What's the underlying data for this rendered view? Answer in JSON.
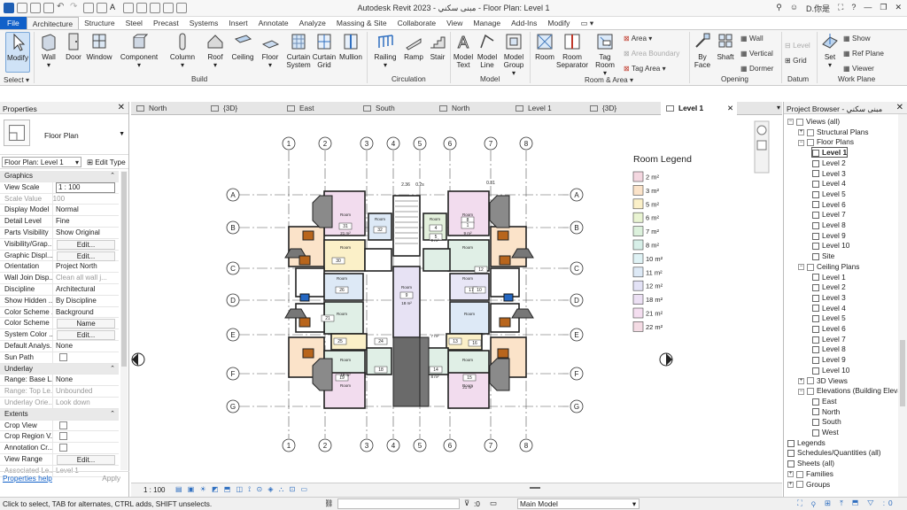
{
  "titlebar": {
    "title": "Autodesk Revit 2023 - مبنى سكني - Floor Plan: Level 1",
    "user": "D.你是"
  },
  "ribbon_tabs": [
    "File",
    "Architecture",
    "Structure",
    "Steel",
    "Precast",
    "Systems",
    "Insert",
    "Annotate",
    "Analyze",
    "Massing & Site",
    "Collaborate",
    "View",
    "Manage",
    "Add-Ins",
    "Modify"
  ],
  "ribbon": {
    "modify": "Modify",
    "wall": "Wall",
    "door": "Door",
    "window": "Window",
    "component": "Component",
    "column": "Column",
    "roof": "Roof",
    "ceiling": "Ceiling",
    "floor": "Floor",
    "curtain_system": "Curtain System",
    "curtain_grid": "Curtain Grid",
    "mullion": "Mullion",
    "railing": "Railing",
    "ramp": "Ramp",
    "stair": "Stair",
    "model_text": "Model Text",
    "model_line": "Model Line",
    "model_group": "Model Group",
    "room": "Room",
    "room_separator": "Room Separator",
    "tag_room": "Tag Room",
    "area": "Area",
    "area_boundary": "Area Boundary",
    "tag_area": "Tag Area",
    "by_face": "By Face",
    "shaft": "Shaft",
    "wall_op": "Wall",
    "vertical": "Vertical",
    "dormer": "Dormer",
    "level": "Level",
    "grid": "Grid",
    "set": "Set",
    "show": "Show",
    "ref_plane": "Ref Plane",
    "viewer": "Viewer",
    "groups": [
      "Select",
      "Build",
      "Circulation",
      "Model",
      "Room & Area",
      "Opening",
      "Datum",
      "Work Plane"
    ]
  },
  "properties": {
    "title": "Properties",
    "type_name": "Floor Plan",
    "filter": "Floor Plan: Level 1",
    "edit_type": "Edit Type",
    "rows": [
      {
        "k": "Graphics",
        "sec": true
      },
      {
        "k": "View Scale",
        "v": "1 : 100",
        "inp": true
      },
      {
        "k": "Scale Value",
        "p2": "1:",
        "v": "100",
        "dim": true
      },
      {
        "k": "Display Model",
        "v": "Normal"
      },
      {
        "k": "Detail Level",
        "v": "Fine"
      },
      {
        "k": "Parts Visibility",
        "v": "Show Original"
      },
      {
        "k": "Visibility/Grap...",
        "v": "Edit...",
        "btn": true
      },
      {
        "k": "Graphic Displ...",
        "v": "Edit...",
        "btn": true
      },
      {
        "k": "Orientation",
        "v": "Project North"
      },
      {
        "k": "Wall Join Disp...",
        "v": "Clean all wall j...",
        "dim2": true
      },
      {
        "k": "Discipline",
        "v": "Architectural"
      },
      {
        "k": "Show Hidden ...",
        "v": "By Discipline"
      },
      {
        "k": "Color Scheme ...",
        "v": "Background"
      },
      {
        "k": "Color Scheme",
        "v": "Name",
        "btn": true
      },
      {
        "k": "System Color ...",
        "v": "Edit...",
        "btn": true
      },
      {
        "k": "Default Analys...",
        "v": "None"
      },
      {
        "k": "Sun Path",
        "chk": true
      },
      {
        "k": "Underlay",
        "sec": true
      },
      {
        "k": "Range: Base L...",
        "v": "None"
      },
      {
        "k": "Range: Top Le...",
        "v": "Unbounded",
        "dim": true
      },
      {
        "k": "Underlay Orie...",
        "v": "Look down",
        "dim": true
      },
      {
        "k": "Extents",
        "sec": true
      },
      {
        "k": "Crop View",
        "chk": true
      },
      {
        "k": "Crop Region V...",
        "chk": true
      },
      {
        "k": "Annotation Cr...",
        "chk": true
      },
      {
        "k": "View Range",
        "v": "Edit...",
        "btn": true
      },
      {
        "k": "Associated Le...",
        "v": "Level 1",
        "dim": true
      }
    ],
    "help": "Properties help",
    "apply": "Apply"
  },
  "view_tabs": [
    "North",
    "{3D}",
    "East",
    "South",
    "North",
    "Level 1",
    "{3D}",
    "Level 1"
  ],
  "scale_label": "1 : 100",
  "legend": {
    "title": "Room Legend",
    "items": [
      {
        "label": "2 m²",
        "color": "#f4d7e0"
      },
      {
        "label": "3 m²",
        "color": "#fbe3c9"
      },
      {
        "label": "5 m²",
        "color": "#fbf0c8"
      },
      {
        "label": "6 m²",
        "color": "#e9f4d2"
      },
      {
        "label": "7 m²",
        "color": "#dcf1dc"
      },
      {
        "label": "8 m²",
        "color": "#d7efe8"
      },
      {
        "label": "10 m²",
        "color": "#dff2f5"
      },
      {
        "label": "11 m²",
        "color": "#dde9f6"
      },
      {
        "label": "12 m²",
        "color": "#e3e2f6"
      },
      {
        "label": "18 m²",
        "color": "#ece0f4"
      },
      {
        "label": "21 m²",
        "color": "#f4def0"
      },
      {
        "label": "22 m²",
        "color": "#f4dbe4"
      }
    ]
  },
  "plan": {
    "col_labels": [
      "1",
      "2",
      "3",
      "4",
      "5",
      "6",
      "7",
      "8"
    ],
    "row_labels": [
      "A",
      "B",
      "C",
      "D",
      "E",
      "F",
      "G"
    ],
    "room_word": "Room",
    "areas": [
      "21 m²",
      "18 m²",
      "9 m²",
      "9 m²",
      "8 m²",
      "7 m²",
      "21 m²",
      "19 m²"
    ],
    "numbers": [
      "31",
      "32",
      "30",
      "25",
      "24",
      "13",
      "26",
      "21",
      "17",
      "16",
      "18",
      "19",
      "14",
      "15",
      "12",
      "10",
      "8",
      "4",
      "5",
      "9",
      "1"
    ],
    "dims": [
      "2.36",
      "0.2s",
      "0.31"
    ]
  },
  "browser": {
    "title": "Project Browser - مبنى سكني",
    "views_all": "Views (all)",
    "structural_plans": "Structural Plans",
    "floor_plans": "Floor Plans",
    "floor_levels": [
      "Level 1",
      "Level 2",
      "Level 3",
      "Level 4",
      "Level 5",
      "Level 6",
      "Level 7",
      "Level 8",
      "Level 9",
      "Level 10",
      "Site"
    ],
    "ceiling_plans": "Ceiling Plans",
    "ceiling_levels": [
      "Level 1",
      "Level 2",
      "Level 3",
      "Level 4",
      "Level 5",
      "Level 6",
      "Level 7",
      "Level 8",
      "Level 9",
      "Level 10"
    ],
    "views_3d": "3D Views",
    "elevations": "Elevations (Building Elevati",
    "elev_items": [
      "East",
      "North",
      "South",
      "West"
    ],
    "legends": "Legends",
    "schedules": "Schedules/Quantities (all)",
    "sheets": "Sheets (all)",
    "families": "Families",
    "groups": "Groups"
  },
  "status": {
    "message": "Click to select, TAB for alternates, CTRL adds, SHIFT unselects.",
    "sel": ":0",
    "model": "Main Model"
  }
}
